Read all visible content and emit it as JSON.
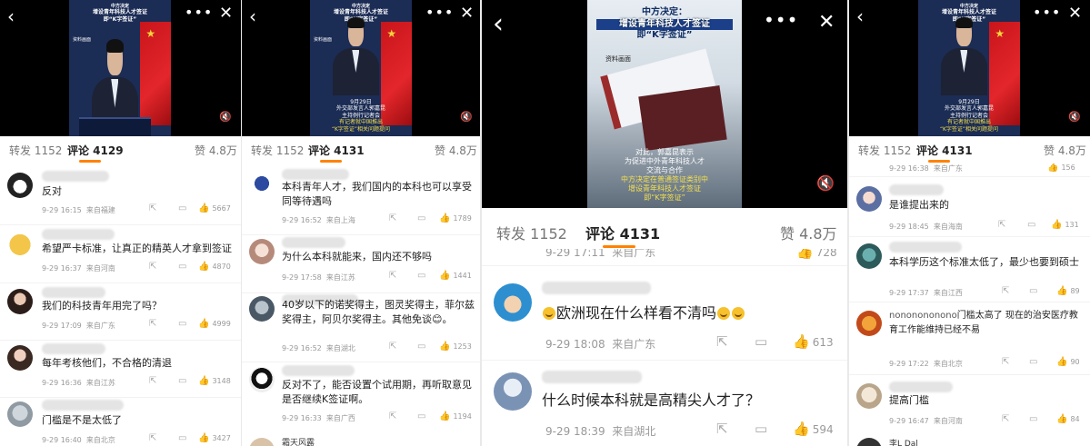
{
  "video_overlay": {
    "banner": [
      "中方决定",
      "增设青年科技人才签证",
      "即“K字签证”"
    ],
    "source": "资料画面",
    "caption": [
      "9月29日",
      "外交部发言人郭嘉昆",
      "主持例行记者会",
      "有记者就中国推出",
      "“K字签证”相关问题提问"
    ],
    "big_banner": [
      "中方决定：",
      "增设青年科技人才签证",
      "即“K字签证”"
    ],
    "big_caption": [
      "对此，郭嘉昆表示",
      "为促进中外青年科技人才",
      "交流与合作",
      "中方决定在普通签证类别中",
      "增设青年科技人才签证",
      "即“K字签证”"
    ],
    "big_source": "资料画面"
  },
  "icons": {
    "back": "back-icon",
    "more": "more-icon",
    "close": "close-icon",
    "mute": "mute-icon",
    "share": "share-icon",
    "reply": "reply-icon",
    "like": "like-icon"
  },
  "colors": {
    "accent": "#ff8200",
    "video_bg": "#000000"
  },
  "panels": [
    {
      "tabs": {
        "repost": "转发 1152",
        "comments": "评论 4129",
        "likes": "赞 4.8万"
      },
      "comments": [
        {
          "text": "反对",
          "time": "9-29 16:15",
          "location": "来自福建",
          "likes": "5667"
        },
        {
          "text": "希望严卡标准，让真正的精英人才拿到签证",
          "time": "9-29 16:37",
          "location": "来自河南",
          "likes": "4870"
        },
        {
          "text": "我们的科技青年用完了吗？",
          "time": "9-29 17:09",
          "location": "来自广东",
          "likes": "4999"
        },
        {
          "text": "每年考核他们，不合格的清退",
          "time": "9-29 16:36",
          "location": "来自江苏",
          "likes": "3148"
        },
        {
          "text": "门槛是不是太低了",
          "time": "9-29 16:40",
          "location": "来自北京",
          "likes": "3427"
        }
      ]
    },
    {
      "tabs": {
        "repost": "转发 1152",
        "comments": "评论 4131",
        "likes": "赞 4.8万"
      },
      "comments": [
        {
          "text": "本科青年人才，我们国内的本科也可以享受同等待遇吗",
          "time": "9-29 16:52",
          "location": "来自上海",
          "likes": "1789"
        },
        {
          "text": "为什么本科就能来，国内还不够吗",
          "time": "9-29 17:58",
          "location": "来自江苏",
          "likes": "1441"
        },
        {
          "text": "40岁以下的诺奖得主，图灵奖得主，菲尔兹奖得主，阿贝尔奖得主。其他免谈😊。",
          "time": "9-29 16:52",
          "location": "来自湖北",
          "likes": "1253"
        },
        {
          "text": "反对不了，能否设置个试用期，再听取意见是否继续K签证啊。",
          "time": "9-29 16:33",
          "location": "来自广西",
          "likes": "1194"
        }
      ],
      "last_name": "霜天风露"
    },
    {
      "tabs": {
        "repost": "转发 1152",
        "comments": "评论 4131",
        "likes": "赞 4.8万"
      },
      "partial_time": "9-29 17:11",
      "partial_location": "来自广东",
      "partial_likes": "728",
      "comments": [
        {
          "text": "欧洲现在什么样看不清吗",
          "time": "9-29 18:08",
          "location": "来自广东",
          "likes": "613"
        },
        {
          "text": "什么时候本科就是高精尖人才了？",
          "time": "9-29 18:39",
          "location": "来自湖北",
          "likes": "594"
        }
      ]
    },
    {
      "tabs": {
        "repost": "转发 1152",
        "comments": "评论 4131",
        "likes": "赞 4.8万"
      },
      "partial_time": "9-29 16:38",
      "partial_location": "来自广东",
      "partial_likes": "156",
      "comments": [
        {
          "text": "是谁提出来的",
          "time": "9-29 18:45",
          "location": "来自海南",
          "likes": "131"
        },
        {
          "text": "本科学历这个标准太低了，最少也要到硕士",
          "time": "9-29 17:37",
          "location": "来自江西",
          "likes": "89"
        },
        {
          "name": "nononononono",
          "text": "门槛太高了 现在的治安医疗教育工作能维持已经不易",
          "time": "9-29 17:22",
          "location": "来自北京",
          "likes": "90"
        },
        {
          "text": "提高门槛",
          "time": "9-29 16:47",
          "location": "来自河南",
          "likes": "84"
        }
      ],
      "last_name": "李L Dal"
    }
  ]
}
